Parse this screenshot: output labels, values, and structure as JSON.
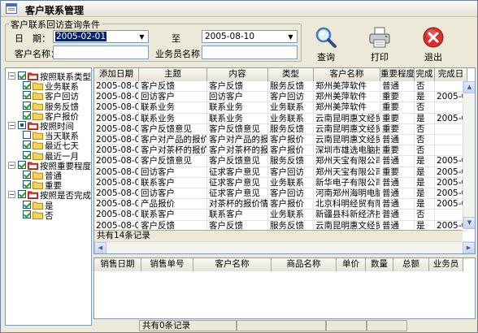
{
  "window": {
    "title": "客户联系管理"
  },
  "query": {
    "group_title": "客户联系回访查询条件",
    "date_label": "日　期：",
    "date_from": "2005-02-01",
    "to_label": "至",
    "date_to": "2005-08-10",
    "customer_label": "客户名称：",
    "customer_value": "",
    "salesman_label": "业务员名称：",
    "salesman_value": ""
  },
  "toolbar": {
    "query_label": "查询",
    "print_label": "打印",
    "exit_label": "退出"
  },
  "tree": [
    {
      "label": "按照联系类型",
      "level": 0,
      "expanded": true,
      "check": "on",
      "icon": "folder-open"
    },
    {
      "label": "业务联系",
      "level": 1,
      "check": "on",
      "icon": "folder"
    },
    {
      "label": "客户回访",
      "level": 1,
      "check": "on",
      "icon": "folder"
    },
    {
      "label": "服务反馈",
      "level": 1,
      "check": "on",
      "icon": "folder"
    },
    {
      "label": "客户报价",
      "level": 1,
      "check": "on",
      "icon": "folder"
    },
    {
      "label": "按照时间",
      "level": 0,
      "expanded": true,
      "check": "part",
      "icon": "folder-open"
    },
    {
      "label": "当天联系",
      "level": 1,
      "check": "off",
      "icon": "folder"
    },
    {
      "label": "最近七天",
      "level": 1,
      "check": "on",
      "icon": "folder"
    },
    {
      "label": "最近一月",
      "level": 1,
      "check": "on",
      "icon": "folder"
    },
    {
      "label": "按照重要程度",
      "level": 0,
      "expanded": true,
      "check": "on",
      "icon": "folder-open"
    },
    {
      "label": "普通",
      "level": 1,
      "check": "on",
      "icon": "folder"
    },
    {
      "label": "重要",
      "level": 1,
      "check": "on",
      "icon": "folder"
    },
    {
      "label": "按照是否完成",
      "level": 0,
      "expanded": true,
      "check": "on",
      "icon": "folder-open"
    },
    {
      "label": "是",
      "level": 1,
      "check": "on",
      "icon": "folder"
    },
    {
      "label": "否",
      "level": 1,
      "check": "on",
      "icon": "folder"
    }
  ],
  "contact_grid": {
    "columns": [
      "添加日期",
      "主题",
      "内容",
      "类型",
      "客户名称",
      "重要程度",
      "完成",
      "完成日"
    ],
    "rows": [
      [
        "2005-08-02",
        "客户反馈",
        "客户反馈",
        "服务反馈",
        "郑州美萍软件",
        "普通",
        "否",
        ""
      ],
      [
        "2005-08-02",
        "回访客户",
        "回访客户",
        "客户回访",
        "郑州美萍软件",
        "重要",
        "是",
        "2005-08-0"
      ],
      [
        "2005-08-02",
        "联系业务",
        "联系业务",
        "业务联系",
        "郑州美萍软件",
        "重要",
        "否",
        ""
      ],
      [
        "2005-08-02",
        "联系业务",
        "联系业务",
        "业务联系",
        "云南昆明惠文经贸有",
        "重要",
        "是",
        "2005-08-0"
      ],
      [
        "2005-08-02",
        "客户反馈意见",
        "客户反馈意见",
        "服务反馈",
        "云南昆明惠文经贸有",
        "重要",
        "否",
        ""
      ],
      [
        "2005-08-02",
        "客户对产品的报价",
        "客户对产品的报价",
        "客户报价",
        "云南昆明惠文经贸有",
        "普通",
        "否",
        ""
      ],
      [
        "2005-08-02",
        "客户对茶杯的报价",
        "客户对茶杯的报价",
        "客户报价",
        "深圳市雄选电脑技术",
        "重要",
        "否",
        ""
      ],
      [
        "2005-08-02",
        "客户反馈意见",
        "客户反馈意见",
        "服务反馈",
        "郑州天宝有限公司",
        "普通",
        "是",
        "2005-08-0"
      ],
      [
        "2005-08-02",
        "回访客户",
        "征求客户意见",
        "客户回访",
        "郑州天宝有限公司",
        "重要",
        "是",
        "2005-08-0"
      ],
      [
        "2005-08-02",
        "联系客户",
        "征求客户意见",
        "业务联系",
        "新华电子有限公司",
        "普通",
        "是",
        "2005-08-0"
      ],
      [
        "2005-08-02",
        "回访客户",
        "征求客户意见",
        "客户回访",
        "河南郑州海明电脑公司",
        "普通",
        "是",
        "2005-08-0"
      ],
      [
        "2005-08-02",
        "产品报价",
        "对茶杯的报价情况",
        "客户报价",
        "北京科明经贸有限公",
        "普通",
        "是",
        "2005-08-0"
      ],
      [
        "2005-08-02",
        "联系客户",
        "联系客户",
        "业务联系",
        "新疆县科新经济技术",
        "普通",
        "否",
        ""
      ],
      [
        "2005-08-02",
        "客户反馈",
        "客户反馈",
        "服务反馈",
        "云南昆明惠文经贸有",
        "普通",
        "是",
        "2005-08-0"
      ]
    ],
    "footer": "共有14条记录"
  },
  "sales_grid": {
    "columns": [
      "销售日期",
      "销售单号",
      "客户名称",
      "商品名称",
      "单价",
      "数量",
      "总额",
      "业务员"
    ],
    "rows": [],
    "footer": "共有0条记录"
  },
  "icons": {
    "title": "app-window-icon",
    "query": "magnifier-icon",
    "print": "printer-icon",
    "exit": "exit-icon",
    "tree_folder": "folder-icon"
  },
  "colors": {
    "selection": "#0a246a",
    "exit_red": "#d8312a",
    "check_green": "#21a121"
  }
}
